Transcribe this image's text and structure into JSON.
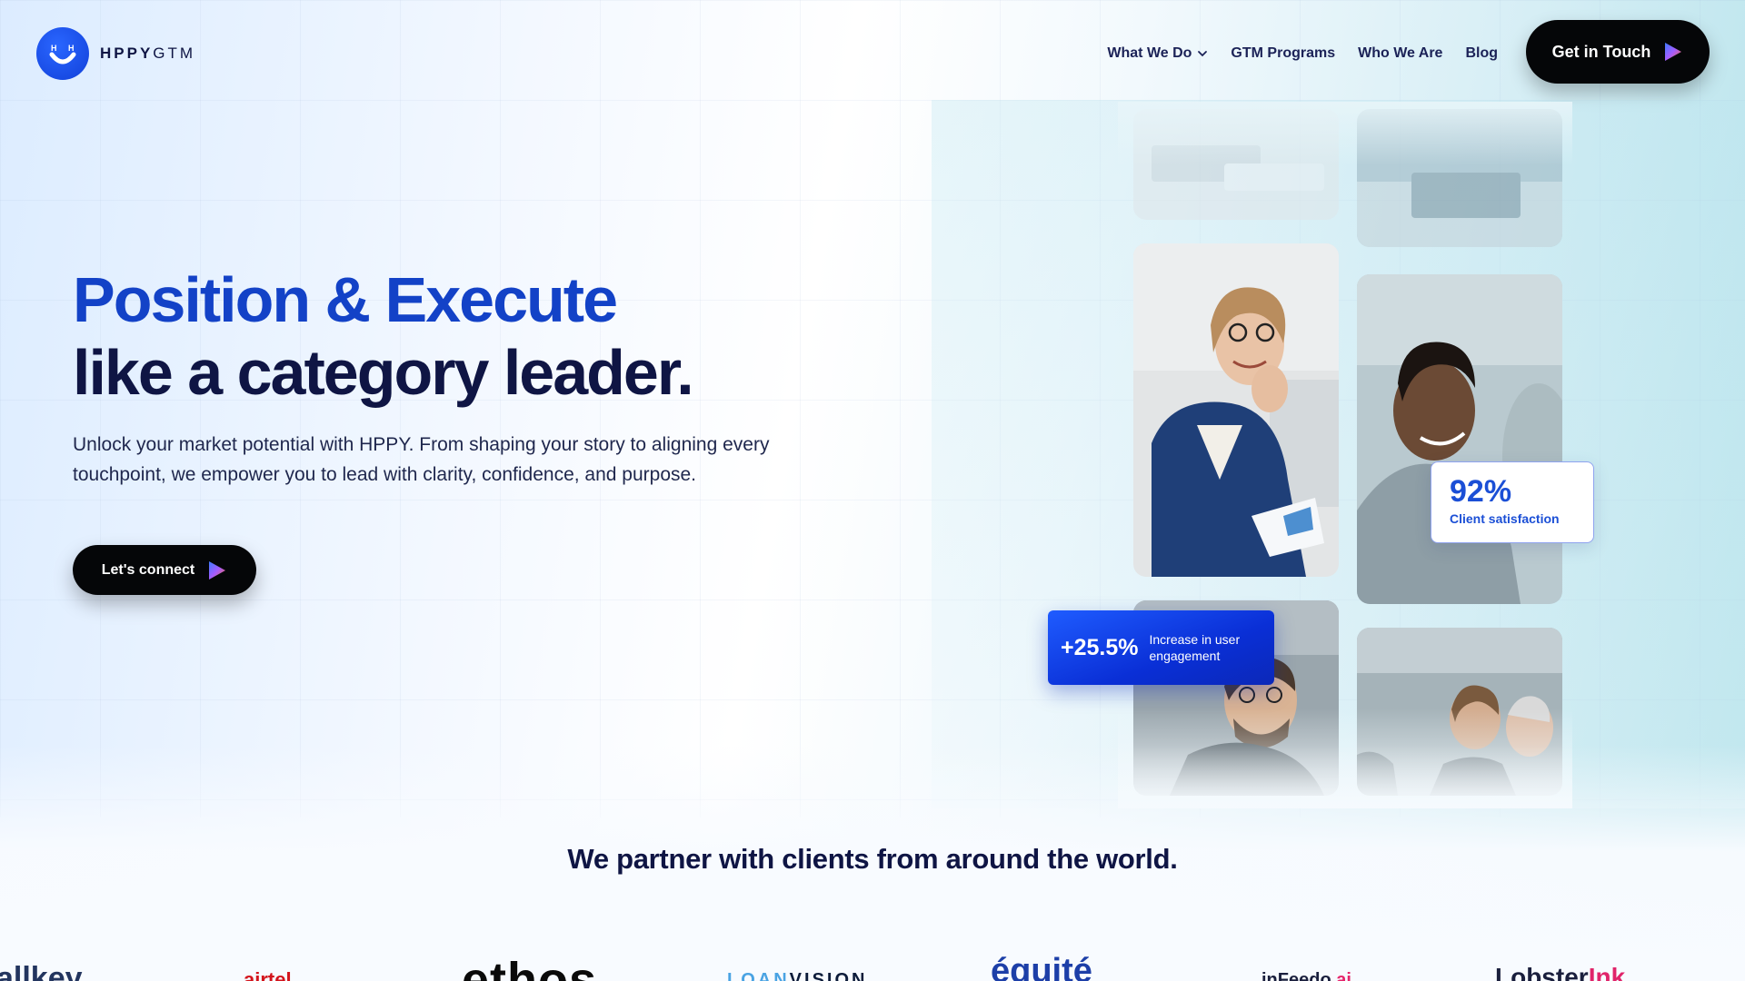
{
  "header": {
    "logo_text_bold": "HPPY",
    "logo_text_light": "GTM",
    "nav": [
      {
        "label": "What We Do",
        "has_dropdown": true
      },
      {
        "label": "GTM Programs"
      },
      {
        "label": "Who We Are"
      },
      {
        "label": "Blog"
      }
    ],
    "cta_label": "Get in Touch"
  },
  "hero": {
    "title_line1": "Position & Execute",
    "title_line2": "like a category leader.",
    "subtitle": "Unlock your market potential with HPPY. From shaping your story to aligning every touchpoint, we empower you to lead with clarity, confidence, and purpose.",
    "cta_label": "Let's connect"
  },
  "stats": {
    "satisfaction_value": "92%",
    "satisfaction_label": "Client satisfaction",
    "engagement_value": "+25.5%",
    "engagement_label": "Increase in user engagement"
  },
  "partners": {
    "heading": "We partner with clients from around the world.",
    "logos": {
      "allkey": "allkey",
      "airtel": "airtel",
      "ethos": "ethos",
      "loanvision_a": "LOAN",
      "loanvision_b": "VISION",
      "equite": "équité",
      "infeedo_a": "inFeedo",
      "infeedo_b": ".ai",
      "lobster_a": "Lobster",
      "lobster_b": "Ink"
    }
  },
  "colors": {
    "brand_blue": "#1342c7",
    "navy": "#0f1544",
    "button_black": "#050608",
    "stat_blue": "#1b4fd6"
  },
  "icons": [
    "logo-smile-icon",
    "chevron-down-icon",
    "play-triangle-icon"
  ]
}
